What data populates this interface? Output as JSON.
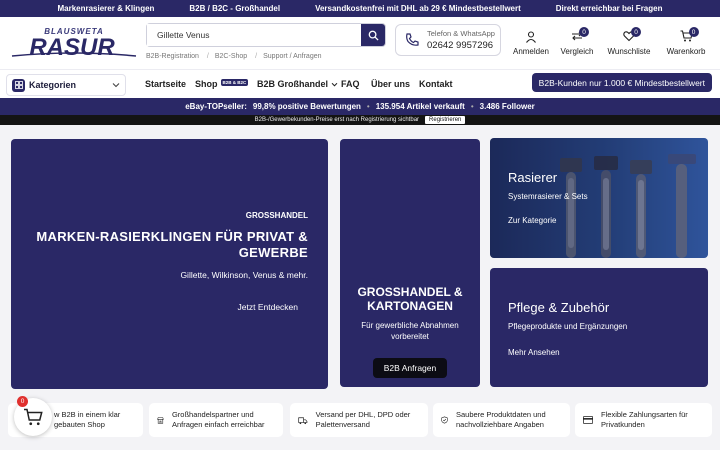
{
  "topbar": [
    " Markenrasierer & Klingen",
    " B2B / B2C - Großhandel",
    " Versandkostenfrei mit DHL ab 29 € Mindestbestellwert",
    " Direkt erreichbar bei Fragen"
  ],
  "logo": {
    "top": "BLAUSWETA",
    "main": "RASUR"
  },
  "search": {
    "value": "Gillette Venus",
    "icon": "search-icon"
  },
  "sublinks": [
    "B2B-Registration",
    "B2C-Shop",
    "Support / Anfragen"
  ],
  "contact": {
    "label": "Telefon & WhatsApp",
    "phone": "02642 9957296"
  },
  "header_icons": {
    "login": "Anmelden",
    "compare": "Vergleich",
    "compare_count": "0",
    "wishlist": "Wunschliste",
    "wishlist_count": "0",
    "cart": "Warenkorb",
    "cart_count": "0"
  },
  "nav": {
    "categories": "Kategorien",
    "home": "Startseite",
    "shop": "Shop",
    "shop_tag": "B2B & B2C",
    "wholesale": "B2B Großhandel",
    "faq": "FAQ",
    "about": "Über uns",
    "contact": "Kontakt",
    "b2b_pill": "B2B-Kunden nur 1.000 € Mindestbestellwert"
  },
  "ebay": {
    "label": "eBay-TOPseller:",
    "rating": "99,8% positive Bewertungen",
    "sold": "135.954 Artikel verkauft",
    "followers": "3.486 Follower"
  },
  "notice": {
    "text": "B2B-/Gewerbekunden-Preise erst nach Registrierung sichtbar",
    "button": "Registrieren"
  },
  "hero": {
    "kicker": "GROSSHANDEL",
    "title": "MARKEN-RASIERKLINGEN FÜR PRIVAT & GEWERBE",
    "sub": "Gillette, Wilkinson, Venus & mehr.",
    "cta": "Jetzt Entdecken"
  },
  "wholesale_card": {
    "title": "GROSSHANDEL & KARTONAGEN",
    "sub": "Für gewerbliche Abnahmen vorbereitet",
    "button": "B2B Anfragen"
  },
  "razor_card": {
    "title": "Rasierer",
    "sub": "Systemrasierer & Sets",
    "cta": "Zur Kategorie"
  },
  "care_card": {
    "title": "Pflege & Zubehör",
    "sub": "Pflegeprodukte und Ergänzungen",
    "cta": "Mehr Ansehen"
  },
  "features": [
    {
      "icon": "shop-icon",
      "text": "B2B in einem klar aufgebauten Shop",
      "visible_text": "w B2B in einem klar\ngebauten Shop"
    },
    {
      "icon": "store-icon",
      "text": "Großhandelspartner und Anfragen einfach erreichbar"
    },
    {
      "icon": "truck-icon",
      "text": "Versand per DHL, DPD oder Palettenversand"
    },
    {
      "icon": "shield-check-icon",
      "text": "Saubere Produktdaten und nachvollziehbare Angaben"
    },
    {
      "icon": "credit-card-icon",
      "text": "Flexible Zahlungsarten für Privatkunden"
    }
  ],
  "floating_cart": {
    "count": "0"
  },
  "colors": {
    "brand": "#2a2866",
    "badge_red": "#e0302e",
    "dark_button": "#0c0c14"
  }
}
